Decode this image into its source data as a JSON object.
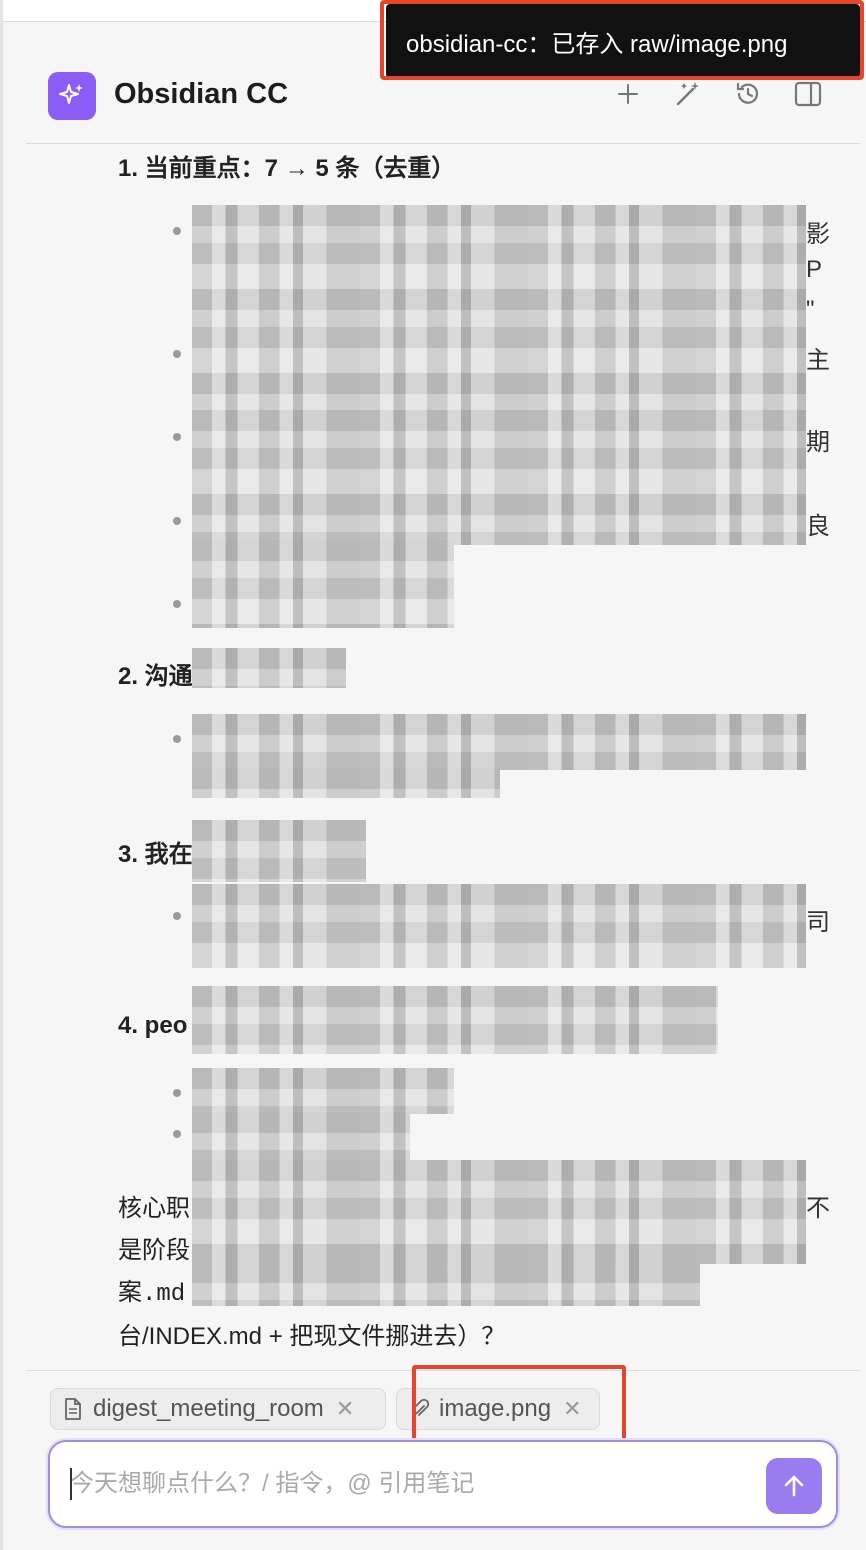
{
  "app": {
    "title": "Obsidian CC"
  },
  "toast": {
    "text": "obsidian-cc：已存入 raw/image.png"
  },
  "header_buttons": [
    "new-chat",
    "magic-wand",
    "history",
    "sidebar-toggle"
  ],
  "message": {
    "heading1": "1. 当前重点：7 → 5 条（去重）",
    "heading2": "2. 沟通",
    "heading3": "3. 我在",
    "heading4": "4. peo",
    "right_chars": [
      "影",
      "P",
      "\"",
      "主",
      "期",
      "良",
      "司",
      "不"
    ],
    "paragraph": {
      "line1": "核心职",
      "line2": "是阶段",
      "line3": "案.md",
      "line4": "台/INDEX.md + 把现文件挪进去）？"
    }
  },
  "attachments": [
    {
      "name": "digest_meeting_room",
      "icon": "document-icon"
    },
    {
      "name": "image.png",
      "icon": "paperclip-icon"
    }
  ],
  "input": {
    "placeholder": "今天想聊点什么？/ 指令，@ 引用笔记"
  },
  "colors": {
    "accent": "#8b5cf6",
    "highlight": "#e5462b",
    "send": "#9b7cf0"
  }
}
